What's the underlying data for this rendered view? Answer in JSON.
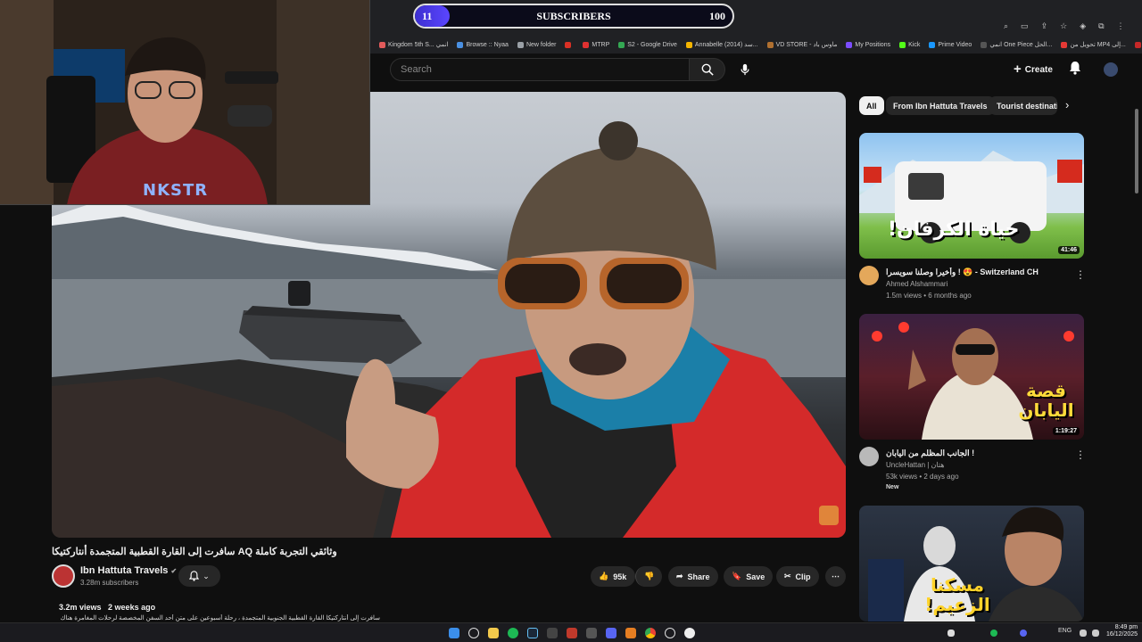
{
  "subscriber_counter": {
    "start": "11",
    "label": "SUBSCRIBERS",
    "end": "100",
    "progress": 0.11
  },
  "bookmarks": [
    {
      "label": "Kingdom 5th S... انمي",
      "color": "#e25b5b"
    },
    {
      "label": "Browse :: Nyaa",
      "color": "#4a90e2"
    },
    {
      "label": "New folder",
      "color": "#9aa0a6"
    },
    {
      "label": "",
      "color": "#d93025"
    },
    {
      "label": "MTRP",
      "color": "#e03131"
    },
    {
      "label": "S2 - Google Drive",
      "color": "#34a853"
    },
    {
      "label": "Annabelle (2014) سد...",
      "color": "#f4b400"
    },
    {
      "label": "VD STORE - ماوس باد",
      "color": "#b07030"
    },
    {
      "label": "My Positions",
      "color": "#7c4dff"
    },
    {
      "label": "Kick",
      "color": "#53fc18"
    },
    {
      "label": "Prime Video",
      "color": "#1a98ff"
    },
    {
      "label": "انمي One Piece الحل...",
      "color": "#555"
    },
    {
      "label": "تحويل من MP4 إلى...",
      "color": "#e53935"
    },
    {
      "label": "Movies",
      "color": "#c62828"
    },
    {
      "label": "All Bookmarks",
      "color": "#9aa0a6"
    }
  ],
  "search": {
    "placeholder": "Search"
  },
  "header": {
    "create_label": "Create"
  },
  "webcam": {
    "shirt_text": "NKSTR"
  },
  "video": {
    "title": "وثائقي التجربة كاملة AQ سافرت إلى القارة القطبية المتجمدة أنتاركتيكا",
    "channel_name": "Ibn Hattuta Travels",
    "channel_subs": "3.28m subscribers",
    "likes": "95k",
    "share_label": "Share",
    "save_label": "Save",
    "clip_label": "Clip",
    "views": "3.2m views",
    "age": "2 weeks ago",
    "description": "سافرت إلى أنتاركتيكا القارة القطبية الجنوبية المتجمدة ، رحلة أسبوعين على متن أحد السفن المخصصة لرحلات المغامرة هناك AQ"
  },
  "chips": [
    "All",
    "From Ibn Hattuta Travels",
    "Tourist destinations"
  ],
  "recommendations": [
    {
      "title": "وأخيرا وصلنا سويسرا ! 😍 - Switzerland CH",
      "channel": "Ahmed Alshammari",
      "views": "1.5m views",
      "age": "6 months ago",
      "duration": "41:46",
      "thumb_text": "حياة الكرفان!",
      "badge": ""
    },
    {
      "title": "الجانب المظلم من اليابان !",
      "channel": "UncleHattan | هتان",
      "views": "53k views",
      "age": "2 days ago",
      "duration": "1:19:27",
      "thumb_text": "قصة اليابان",
      "badge": "New"
    },
    {
      "title": "",
      "channel": "",
      "views": "",
      "age": "",
      "duration": "",
      "thumb_text": "مسكنا الزعيم!",
      "badge": ""
    }
  ],
  "taskbar": {
    "lang": "ENG",
    "time": "8:49 pm",
    "date": "16/12/2025"
  },
  "colors": {
    "accent_red": "#ff0000",
    "counter_fill": "#4b3cf0",
    "bg": "#0f0f0f"
  }
}
